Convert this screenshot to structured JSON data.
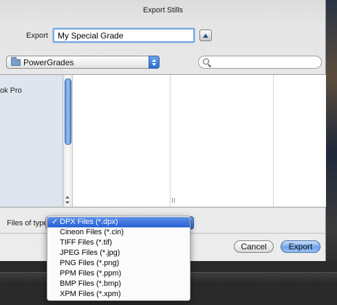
{
  "dialog": {
    "title": "Export Stills",
    "export_label": "Export",
    "file_name": "My Special Grade",
    "location": "PowerGrades",
    "search_placeholder": "",
    "sidebar_items": [
      "ok Pro"
    ],
    "files_of_type_label": "Files of type",
    "cancel_label": "Cancel",
    "export_button_label": "Export"
  },
  "file_types": {
    "selected": "DPX Files (*.dpx)",
    "checkmark": "✓",
    "options": [
      "DPX Files (*.dpx)",
      "Cineon Files (*.cin)",
      "TIFF Files (*.tif)",
      "JPEG Files (*.jpg)",
      "PNG Files (*.png)",
      "PPM Files (*.ppm)",
      "BMP Files (*.bmp)",
      "XPM Files (*.xpm)"
    ]
  },
  "icons": {
    "folder": "folder-icon",
    "search": "search-icon",
    "collapse": "disclosure-up-icon",
    "check": "checkmark-icon"
  },
  "colors": {
    "accent": "#2660d6",
    "focus_ring": "#7ba7e0"
  }
}
